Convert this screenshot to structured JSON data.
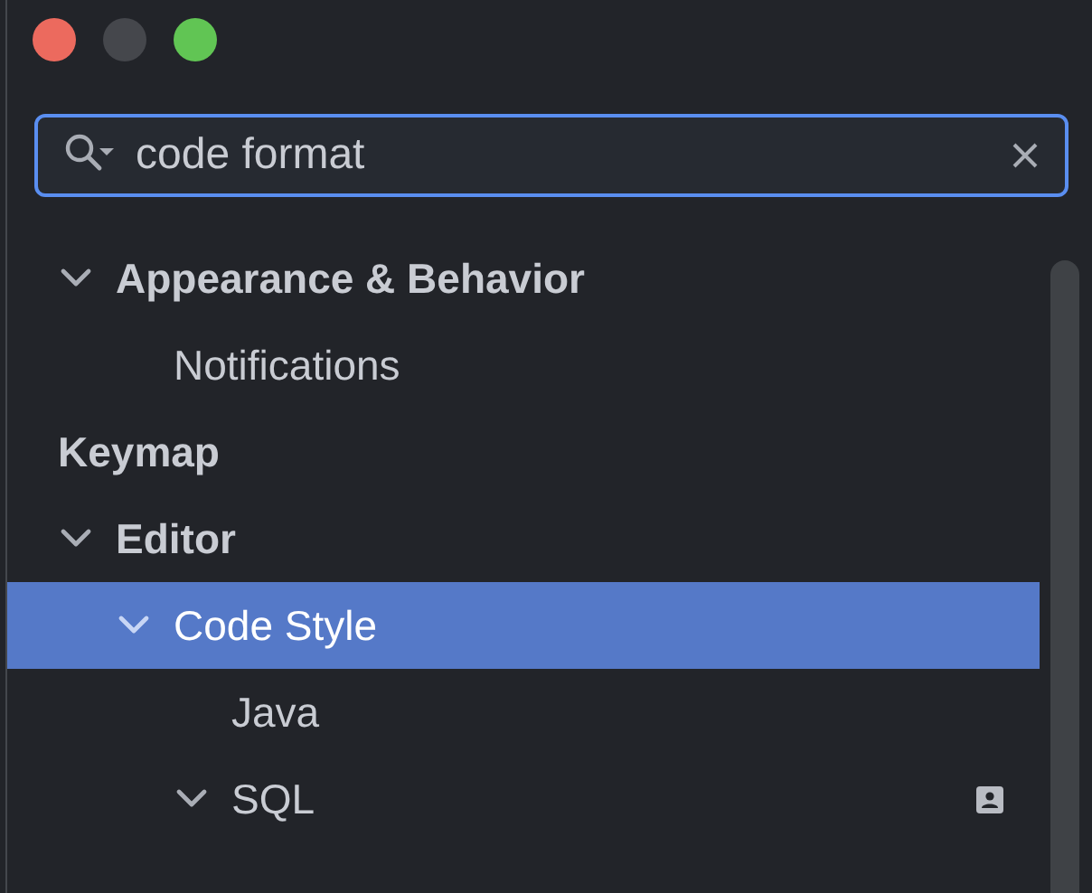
{
  "search": {
    "value": "code format"
  },
  "tree": [
    {
      "label": "Appearance & Behavior",
      "expanded": true,
      "selected": false,
      "children": [
        {
          "label": "Notifications",
          "selected": false
        }
      ]
    },
    {
      "label": "Keymap",
      "selected": false
    },
    {
      "label": "Editor",
      "expanded": true,
      "selected": false,
      "children": [
        {
          "label": "Code Style",
          "expanded": true,
          "selected": true,
          "children": [
            {
              "label": "Java",
              "selected": false
            },
            {
              "label": "SQL",
              "expanded": true,
              "selected": false,
              "project_badge": true
            }
          ]
        }
      ]
    }
  ]
}
